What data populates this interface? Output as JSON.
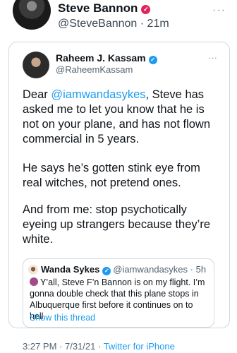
{
  "outer": {
    "name": "Steve Bannon",
    "handle": "@SteveBannon",
    "time": "21m",
    "more": "···"
  },
  "tweet": {
    "name": "Raheem J. Kassam",
    "handle": "@RaheemKassam",
    "more": "···",
    "p1_pre": "Dear ",
    "p1_mention": "@iamwandasykes",
    "p1_post": ", Steve has asked me to let you know that he is not on your plane, and has not flown commercial in 5 years.",
    "p2": "He says he’s gotten stink eye from real witches, not pretend ones.",
    "p3": "And from me: stop psychotically eyeing up strangers because they’re white."
  },
  "quote": {
    "name": "Wanda Sykes",
    "handle": "@iamwandasykes",
    "time": "5h",
    "text": "Y’all, Steve F’n Bannon is on my flight.  I’m gonna double check that this plane stops in Albuquerque first before it continues on to hell.",
    "show_thread": "Show this thread"
  },
  "footer": {
    "time": "3:27 PM",
    "date": "7/31/21",
    "source": "Twitter for iPhone"
  },
  "colors": {
    "link": "#1d9bf0",
    "verified_red": "#e0245e",
    "verified_blue": "#1d9bf0"
  }
}
